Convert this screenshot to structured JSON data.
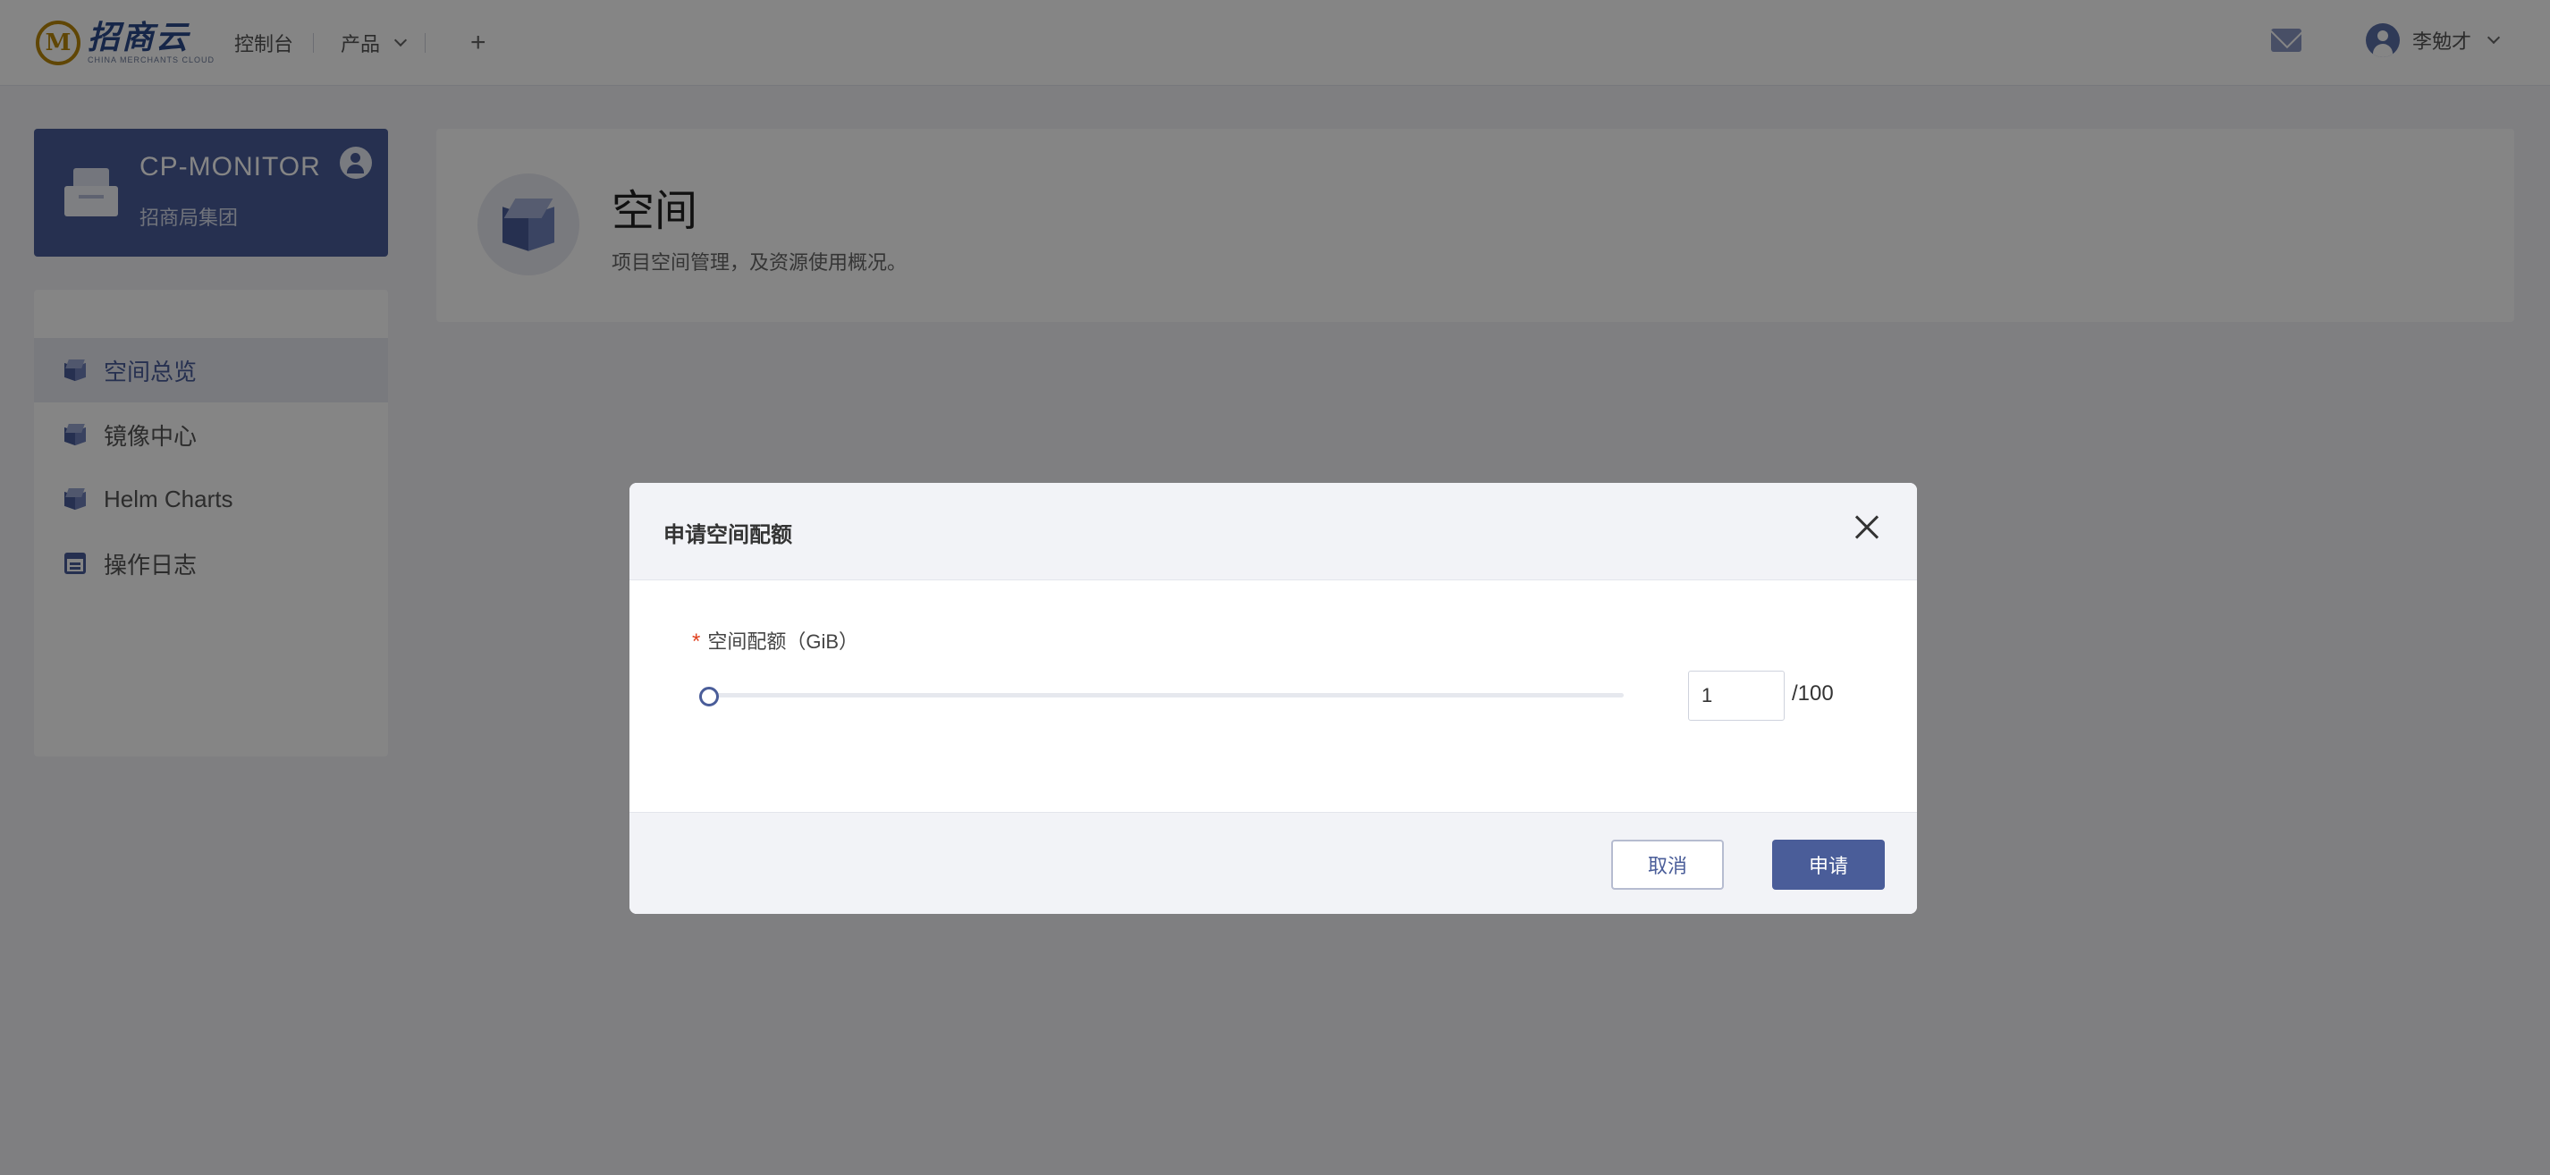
{
  "header": {
    "logo_text": "招商云",
    "logo_sub": "CHINA MERCHANTS CLOUD",
    "nav": [
      {
        "label": "控制台"
      },
      {
        "label": "产品"
      }
    ],
    "add_icon": "+",
    "user_name": "李勉才"
  },
  "project": {
    "name": "CP-MONITOR",
    "org": "招商局集团"
  },
  "sidebar": {
    "items": [
      {
        "label": "空间总览",
        "icon": "cube-icon",
        "active": true
      },
      {
        "label": "镜像中心",
        "icon": "cube-icon",
        "active": false
      },
      {
        "label": "Helm Charts",
        "icon": "cube-icon",
        "active": false
      },
      {
        "label": "操作日志",
        "icon": "calendar-icon",
        "active": false
      }
    ]
  },
  "page": {
    "title": "空间",
    "description": "项目空间管理，及资源使用概况。"
  },
  "modal": {
    "title": "申请空间配额",
    "field_label": "空间配额（GiB）",
    "required_mark": "*",
    "value": "1",
    "max_label": "/100",
    "slider_value": 1,
    "slider_max": 100,
    "cancel_label": "取消",
    "submit_label": "申请"
  },
  "colors": {
    "primary": "#4a5d99",
    "required": "#e0411f",
    "overlay": "rgba(0,0,0,0.48)"
  }
}
